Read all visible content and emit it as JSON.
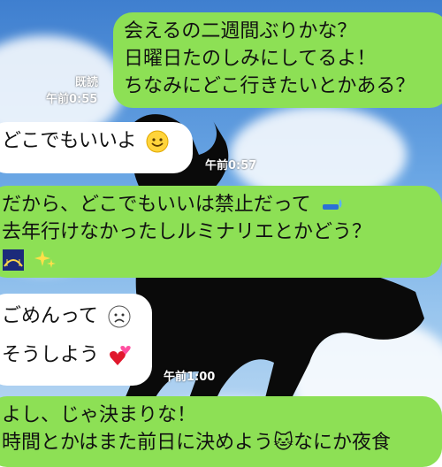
{
  "messages": [
    {
      "lines": [
        "会えるの二週間ぶりかな？",
        "日曜日たのしみにしてるよ！",
        "ちなみにどこ行きたいとかある？"
      ]
    },
    {
      "lines": [
        "どこでもいいよ"
      ],
      "emoji": "smiling-face-emoji"
    },
    {
      "lines": [
        "だから、どこでもいいは禁止だって",
        "去年行けなかったしルミナリエとかどう？"
      ],
      "emoji_line1": "sweat-face-emoji",
      "emoji_line2": [
        "night-bridge-emoji",
        "sparkles-emoji"
      ]
    },
    {
      "lines": [
        "ごめんって",
        "そうしよう"
      ],
      "emoji_line1": "sad-face-emoji",
      "emoji_line2": "hearts-emoji"
    },
    {
      "lines": [
        "よし、じゃ決まりな！",
        "時間とかはまた前日に決めよう🐱なにか夜食"
      ]
    }
  ],
  "meta": {
    "read_label": "既読",
    "time1": "午前0:55",
    "time2": "午前0:57",
    "time3": "午前1:00"
  },
  "colors": {
    "green_bubble": "#8de055",
    "white_bubble": "#ffffff"
  }
}
